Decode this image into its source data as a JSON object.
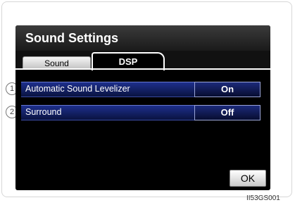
{
  "screen": {
    "title": "Sound Settings",
    "tabs": [
      {
        "label": "Sound",
        "active": false
      },
      {
        "label": "DSP",
        "active": true
      }
    ],
    "settings": [
      {
        "label": "Automatic Sound Levelizer",
        "value": "On"
      },
      {
        "label": "Surround",
        "value": "Off"
      }
    ],
    "ok_label": "OK"
  },
  "callouts": [
    "1",
    "2"
  ],
  "image_code": "II53GS001"
}
